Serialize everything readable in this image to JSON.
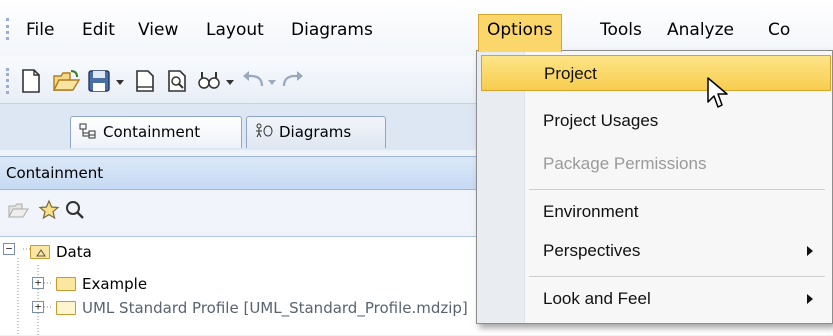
{
  "menubar": {
    "items": [
      "File",
      "Edit",
      "View",
      "Layout",
      "Diagrams",
      "Options",
      "Tools",
      "Analyze",
      "Co"
    ],
    "active": "Options"
  },
  "toolbar": {
    "icons": [
      "new-icon",
      "open-icon",
      "save-icon",
      "dropdown-arrow-icon",
      "page-icon",
      "print-preview-icon",
      "find-icon",
      "dropdown-arrow-icon",
      "undo-icon",
      "dropdown-arrow-icon",
      "redo-icon"
    ]
  },
  "tabs": [
    {
      "label": "Containment",
      "icon": "containment-icon"
    },
    {
      "label": "Diagrams",
      "icon": "diagrams-icon"
    }
  ],
  "panel": {
    "title": "Containment",
    "tools": [
      "open-folder-icon",
      "star-icon",
      "search-icon"
    ]
  },
  "tree": {
    "rows": [
      {
        "label": "Data",
        "expanded": true
      },
      {
        "label": "Example",
        "expanded": false
      },
      {
        "label": "UML Standard Profile [UML_Standard_Profile.mdzip]",
        "expanded": false
      }
    ]
  },
  "options_menu": {
    "items": [
      {
        "label": "Project",
        "highlighted": true,
        "enabled": true
      },
      {
        "label": "Project Usages",
        "enabled": true
      },
      {
        "label": "Package Permissions",
        "enabled": false
      },
      {
        "label": "Environment",
        "enabled": true
      },
      {
        "label": "Perspectives",
        "submenu": true,
        "enabled": true
      },
      {
        "label": "Look and Feel",
        "submenu": true,
        "enabled": true
      }
    ]
  },
  "colors": {
    "menu_highlight": "#fbd66a",
    "panel_header": "#c7daf3",
    "disabled_text": "#9a9a9a"
  }
}
